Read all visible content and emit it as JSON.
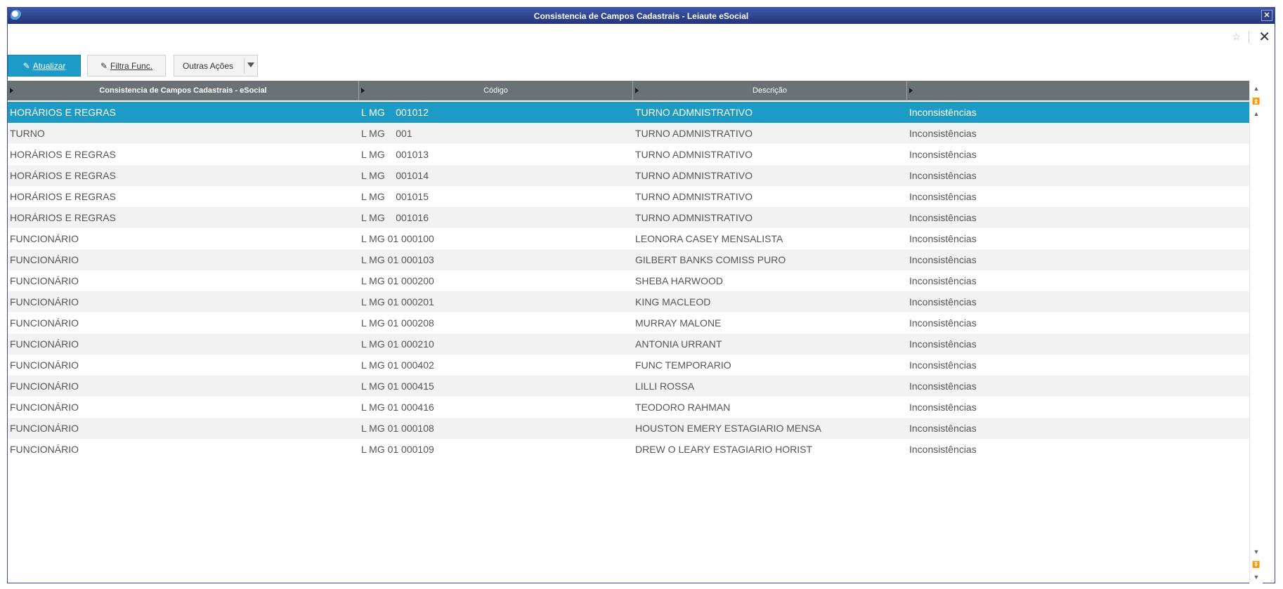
{
  "window": {
    "title": "Consistencia de Campos Cadastrais - Leiaute eSocial"
  },
  "toolbar": {
    "atualizar_label": "Atualizar",
    "filtra_label": "Filtra Func.",
    "outras_label": "Outras Ações"
  },
  "grid": {
    "headers": [
      "Consistencia de Campos Cadastrais - eSocial",
      "Código",
      "Descrição",
      ""
    ],
    "rows": [
      {
        "tipo": "HORÁRIOS E REGRAS",
        "codigo": "L MG    001012",
        "descricao": "TURNO ADMNISTRATIVO",
        "status": "Inconsistências"
      },
      {
        "tipo": "TURNO",
        "codigo": "L MG    001",
        "descricao": "TURNO ADMNISTRATIVO",
        "status": "Inconsistências"
      },
      {
        "tipo": "HORÁRIOS E REGRAS",
        "codigo": "L MG    001013",
        "descricao": "TURNO ADMNISTRATIVO",
        "status": "Inconsistências"
      },
      {
        "tipo": "HORÁRIOS E REGRAS",
        "codigo": "L MG    001014",
        "descricao": "TURNO ADMNISTRATIVO",
        "status": "Inconsistências"
      },
      {
        "tipo": "HORÁRIOS E REGRAS",
        "codigo": "L MG    001015",
        "descricao": "TURNO ADMNISTRATIVO",
        "status": "Inconsistências"
      },
      {
        "tipo": "HORÁRIOS E REGRAS",
        "codigo": "L MG    001016",
        "descricao": "TURNO ADMNISTRATIVO",
        "status": "Inconsistências"
      },
      {
        "tipo": "FUNCIONÁRIO",
        "codigo": "L MG 01 000100",
        "descricao": "LEONORA CASEY MENSALISTA",
        "status": "Inconsistências"
      },
      {
        "tipo": "FUNCIONÁRIO",
        "codigo": "L MG 01 000103",
        "descricao": "GILBERT BANKS COMISS PURO",
        "status": "Inconsistências"
      },
      {
        "tipo": "FUNCIONÁRIO",
        "codigo": "L MG 01 000200",
        "descricao": "SHEBA HARWOOD",
        "status": "Inconsistências"
      },
      {
        "tipo": "FUNCIONÁRIO",
        "codigo": "L MG 01 000201",
        "descricao": "KING MACLEOD",
        "status": "Inconsistências"
      },
      {
        "tipo": "FUNCIONÁRIO",
        "codigo": "L MG 01 000208",
        "descricao": "MURRAY MALONE",
        "status": "Inconsistências"
      },
      {
        "tipo": "FUNCIONÁRIO",
        "codigo": "L MG 01 000210",
        "descricao": "ANTONIA URRANT",
        "status": "Inconsistências"
      },
      {
        "tipo": "FUNCIONÁRIO",
        "codigo": "L MG 01 000402",
        "descricao": "FUNC TEMPORARIO",
        "status": "Inconsistências"
      },
      {
        "tipo": "FUNCIONÁRIO",
        "codigo": "L MG 01 000415",
        "descricao": "LILLI ROSSA",
        "status": "Inconsistências"
      },
      {
        "tipo": "FUNCIONÁRIO",
        "codigo": "L MG 01 000416",
        "descricao": "TEODORO RAHMAN",
        "status": "Inconsistências"
      },
      {
        "tipo": "FUNCIONÁRIO",
        "codigo": "L MG 01 000108",
        "descricao": "HOUSTON EMERY ESTAGIARIO MENSA",
        "status": "Inconsistências"
      },
      {
        "tipo": "FUNCIONÁRIO",
        "codigo": "L MG 01 000109",
        "descricao": "DREW O LEARY ESTAGIARIO HORIST",
        "status": "Inconsistências"
      }
    ]
  },
  "colors": {
    "accent": "#1c9bc9",
    "header": "#6a7275",
    "titlebar": "#2d3f88"
  },
  "icons": [
    "app-icon",
    "star-icon",
    "close-icon",
    "pencil-icon",
    "chevron-down-icon"
  ]
}
